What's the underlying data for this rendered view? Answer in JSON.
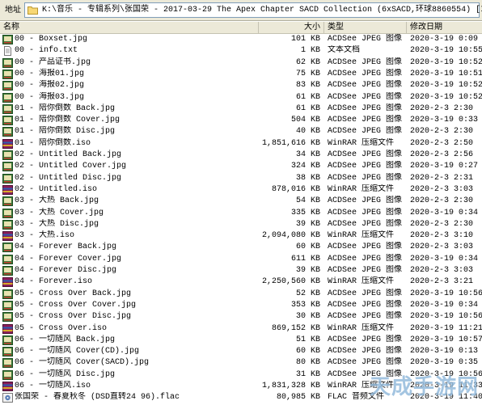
{
  "address": {
    "label": "地址",
    "path": "K:\\音乐 - 专辑系列\\张国荣 - 2017-03-29 The Apex Chapter SACD Collection (6xSACD,环球8860554) [ISO]"
  },
  "columns": {
    "name": "名称",
    "size": "大小",
    "type": "类型",
    "modified": "修改日期"
  },
  "files": [
    {
      "icon": "jpg-file-icon",
      "name": "00 - Boxset.jpg",
      "size": "101 KB",
      "type": "ACDSee JPEG 图像",
      "date": "2020-3-19 0:09"
    },
    {
      "icon": "txt-file-icon",
      "name": "00 - info.txt",
      "size": "1 KB",
      "type": "文本文档",
      "date": "2020-3-19 10:55"
    },
    {
      "icon": "jpg-file-icon",
      "name": "00 - 产品证书.jpg",
      "size": "62 KB",
      "type": "ACDSee JPEG 图像",
      "date": "2020-3-19 10:52"
    },
    {
      "icon": "jpg-file-icon",
      "name": "00 - 海报01.jpg",
      "size": "75 KB",
      "type": "ACDSee JPEG 图像",
      "date": "2020-3-19 10:51"
    },
    {
      "icon": "jpg-file-icon",
      "name": "00 - 海报02.jpg",
      "size": "83 KB",
      "type": "ACDSee JPEG 图像",
      "date": "2020-3-19 10:52"
    },
    {
      "icon": "jpg-file-icon",
      "name": "00 - 海报03.jpg",
      "size": "61 KB",
      "type": "ACDSee JPEG 图像",
      "date": "2020-3-19 10:52"
    },
    {
      "icon": "jpg-file-icon",
      "name": "01 - 陪你倒数 Back.jpg",
      "size": "61 KB",
      "type": "ACDSee JPEG 图像",
      "date": "2020-2-3 2:30"
    },
    {
      "icon": "jpg-file-icon",
      "name": "01 - 陪你倒数 Cover.jpg",
      "size": "504 KB",
      "type": "ACDSee JPEG 图像",
      "date": "2020-3-19 0:33"
    },
    {
      "icon": "jpg-file-icon",
      "name": "01 - 陪你倒数 Disc.jpg",
      "size": "40 KB",
      "type": "ACDSee JPEG 图像",
      "date": "2020-2-3 2:30"
    },
    {
      "icon": "rar-file-icon",
      "name": "01 - 陪你倒数.iso",
      "size": "1,851,616 KB",
      "type": "WinRAR 压缩文件",
      "date": "2020-2-3 2:50"
    },
    {
      "icon": "jpg-file-icon",
      "name": "02 - Untitled Back.jpg",
      "size": "34 KB",
      "type": "ACDSee JPEG 图像",
      "date": "2020-2-3 2:56"
    },
    {
      "icon": "jpg-file-icon",
      "name": "02 - Untitled Cover.jpg",
      "size": "324 KB",
      "type": "ACDSee JPEG 图像",
      "date": "2020-3-19 0:27"
    },
    {
      "icon": "jpg-file-icon",
      "name": "02 - Untitled Disc.jpg",
      "size": "38 KB",
      "type": "ACDSee JPEG 图像",
      "date": "2020-2-3 2:31"
    },
    {
      "icon": "rar-file-icon",
      "name": "02 - Untitled.iso",
      "size": "878,016 KB",
      "type": "WinRAR 压缩文件",
      "date": "2020-2-3 3:03"
    },
    {
      "icon": "jpg-file-icon",
      "name": "03 - 大热 Back.jpg",
      "size": "54 KB",
      "type": "ACDSee JPEG 图像",
      "date": "2020-2-3 2:30"
    },
    {
      "icon": "jpg-file-icon",
      "name": "03 - 大热 Cover.jpg",
      "size": "335 KB",
      "type": "ACDSee JPEG 图像",
      "date": "2020-3-19 0:34"
    },
    {
      "icon": "jpg-file-icon",
      "name": "03 - 大热 Disc.jpg",
      "size": "39 KB",
      "type": "ACDSee JPEG 图像",
      "date": "2020-2-3 2:30"
    },
    {
      "icon": "rar-file-icon",
      "name": "03 - 大热.iso",
      "size": "2,094,080 KB",
      "type": "WinRAR 压缩文件",
      "date": "2020-2-3 3:10"
    },
    {
      "icon": "jpg-file-icon",
      "name": "04 - Forever Back.jpg",
      "size": "60 KB",
      "type": "ACDSee JPEG 图像",
      "date": "2020-2-3 3:03"
    },
    {
      "icon": "jpg-file-icon",
      "name": "04 - Forever Cover.jpg",
      "size": "611 KB",
      "type": "ACDSee JPEG 图像",
      "date": "2020-3-19 0:34"
    },
    {
      "icon": "jpg-file-icon",
      "name": "04 - Forever Disc.jpg",
      "size": "39 KB",
      "type": "ACDSee JPEG 图像",
      "date": "2020-2-3 3:03"
    },
    {
      "icon": "rar-file-icon",
      "name": "04 - Forever.iso",
      "size": "2,250,560 KB",
      "type": "WinRAR 压缩文件",
      "date": "2020-2-3 3:21"
    },
    {
      "icon": "jpg-file-icon",
      "name": "05 - Cross Over Back.jpg",
      "size": "52 KB",
      "type": "ACDSee JPEG 图像",
      "date": "2020-3-19 10:56"
    },
    {
      "icon": "jpg-file-icon",
      "name": "05 - Cross Over Cover.jpg",
      "size": "353 KB",
      "type": "ACDSee JPEG 图像",
      "date": "2020-3-19 0:34"
    },
    {
      "icon": "jpg-file-icon",
      "name": "05 - Cross Over Disc.jpg",
      "size": "30 KB",
      "type": "ACDSee JPEG 图像",
      "date": "2020-3-19 10:56"
    },
    {
      "icon": "rar-file-icon",
      "name": "05 - Cross Over.iso",
      "size": "869,152 KB",
      "type": "WinRAR 压缩文件",
      "date": "2020-3-19 11:21"
    },
    {
      "icon": "jpg-file-icon",
      "name": "06 - 一切随风 Back.jpg",
      "size": "51 KB",
      "type": "ACDSee JPEG 图像",
      "date": "2020-3-19 10:57"
    },
    {
      "icon": "jpg-file-icon",
      "name": "06 - 一切随风 Cover(CD).jpg",
      "size": "60 KB",
      "type": "ACDSee JPEG 图像",
      "date": "2020-3-19 0:13"
    },
    {
      "icon": "jpg-file-icon",
      "name": "06 - 一切随风 Cover(SACD).jpg",
      "size": "80 KB",
      "type": "ACDSee JPEG 图像",
      "date": "2020-3-19 0:35"
    },
    {
      "icon": "jpg-file-icon",
      "name": "06 - 一切随风 Disc.jpg",
      "size": "31 KB",
      "type": "ACDSee JPEG 图像",
      "date": "2020-3-19 10:56"
    },
    {
      "icon": "rar-file-icon",
      "name": "06 - 一切随风.iso",
      "size": "1,831,328 KB",
      "type": "WinRAR 压缩文件",
      "date": "2020-3-19 11:33"
    },
    {
      "icon": "flac-file-icon",
      "name": "张国荣 - 春夏秋冬 (DSD直转24 96).flac",
      "size": "80,985 KB",
      "type": "FLAC 音频文件",
      "date": "2020-3-19 11:40"
    }
  ],
  "watermark": "天成手游网"
}
